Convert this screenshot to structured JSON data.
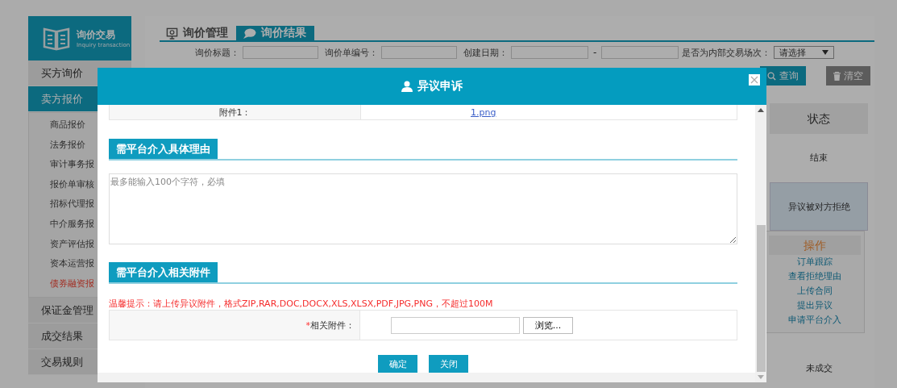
{
  "sidebar": {
    "logo_title": "询价交易",
    "logo_subtitle": "Inquiry transaction",
    "items": [
      {
        "label": "买方询价",
        "selected": false
      },
      {
        "label": "卖方报价",
        "selected": true,
        "children": [
          {
            "label": "商品报价",
            "selected": false
          },
          {
            "label": "法务报价",
            "selected": false
          },
          {
            "label": "审计事务报",
            "selected": false
          },
          {
            "label": "报价单审核",
            "selected": false
          },
          {
            "label": "招标代理报",
            "selected": false
          },
          {
            "label": "中介服务报",
            "selected": false
          },
          {
            "label": "资产评估报",
            "selected": false
          },
          {
            "label": "资本运营报",
            "selected": false
          },
          {
            "label": "债券融资报",
            "selected": true
          }
        ]
      },
      {
        "label": "保证金管理",
        "selected": false
      },
      {
        "label": "成交结果",
        "selected": false
      },
      {
        "label": "交易规则",
        "selected": false
      }
    ]
  },
  "tabs": [
    {
      "label": "询价管理",
      "selected": false
    },
    {
      "label": "询价结果",
      "selected": true
    }
  ],
  "filters": [
    {
      "kind": "text",
      "label": "询价标题："
    },
    {
      "kind": "text",
      "label": "询价单编号："
    },
    {
      "kind": "range",
      "label": "创建日期：",
      "separator": "-"
    },
    {
      "kind": "select",
      "label": "是否为内部交易场次：",
      "value": "请选择"
    }
  ],
  "search_button": "查询",
  "clear_button": "清空",
  "table": {
    "status_header": "状态",
    "rows": [
      {
        "status": "结束",
        "selected": false
      },
      {
        "status": "异议被对方拒绝",
        "selected": true
      },
      {
        "status": "未成交",
        "selected": false
      }
    ]
  },
  "action_menu": {
    "title": "操作",
    "items": [
      "订单跟踪",
      "查看拒绝理由",
      "上传合同",
      "提出异议",
      "申请平台介入"
    ]
  },
  "dialog": {
    "title": "异议申诉",
    "attachment": {
      "label": "附件1：",
      "link": "1.png"
    },
    "reason_section": "需平台介入具体理由",
    "reason_placeholder": "最多能输入100个字符，必填",
    "files_section": "需平台介入相关附件",
    "hint": "温馨提示：请上传异议附件，格式ZIP,RAR,DOC,DOCX,XLS,XLSX,PDF,JPG,PNG，不超过100M",
    "file_field": {
      "required_mark": "*",
      "label": "相关附件：",
      "browse": "浏览..."
    },
    "buttons": [
      "确定",
      "关闭"
    ]
  }
}
